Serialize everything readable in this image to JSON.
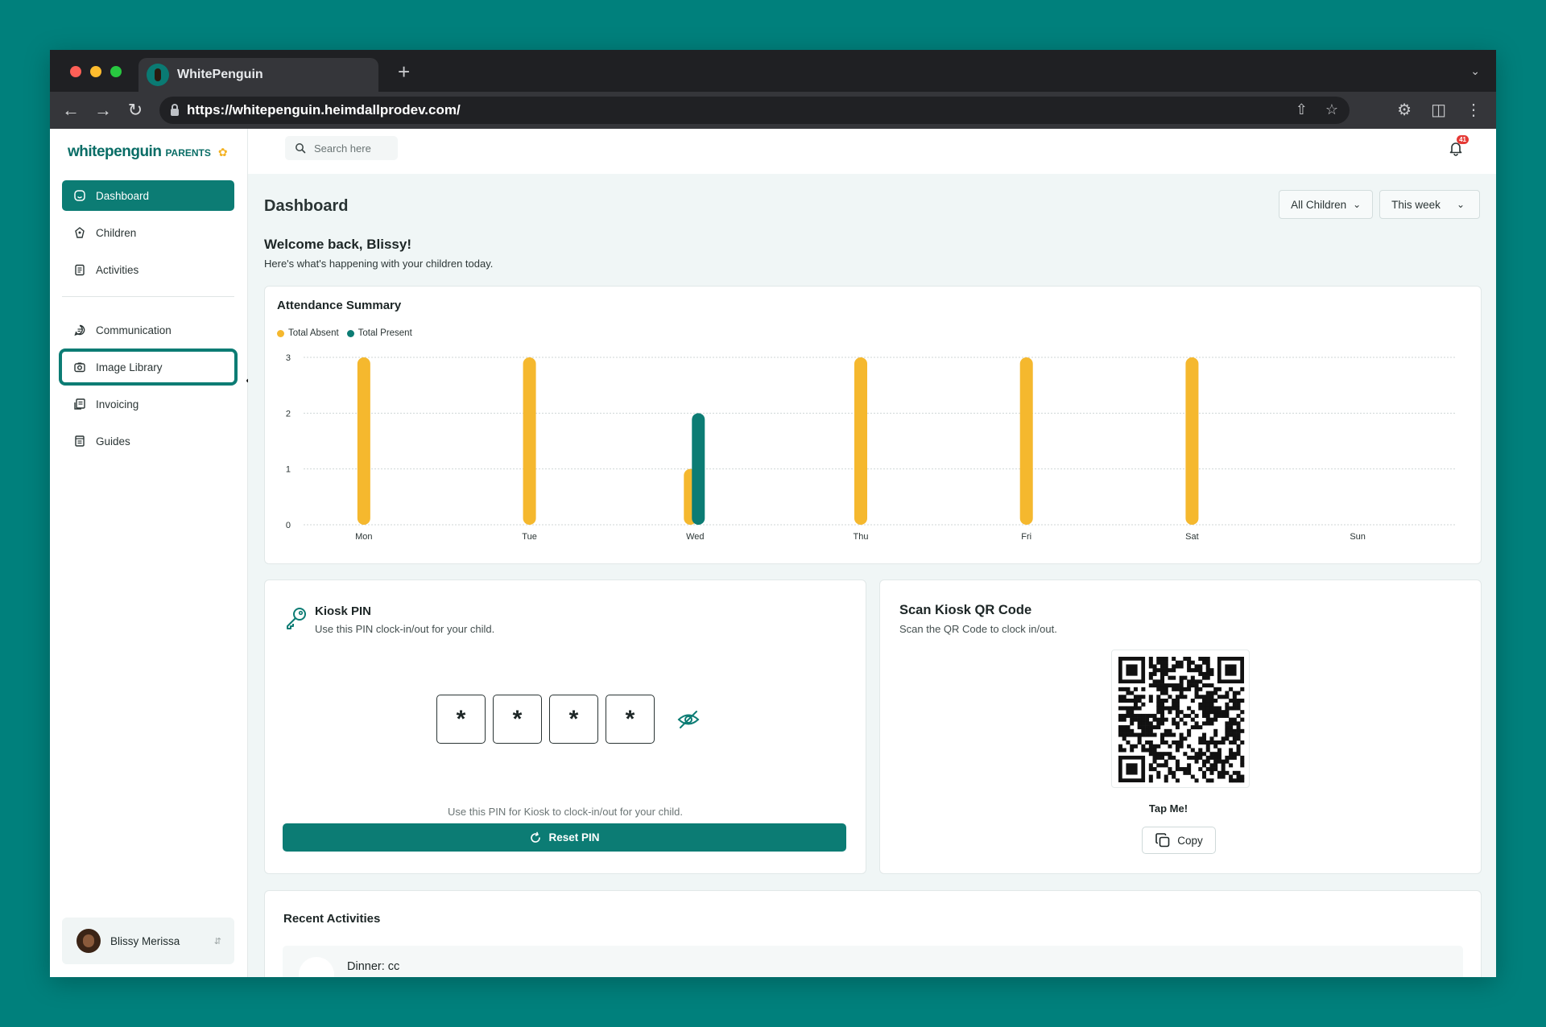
{
  "browser": {
    "tab_title": "WhitePenguin",
    "url": "https://whitepenguin.heimdallprodev.com/"
  },
  "brand": {
    "name": "whitepenguin",
    "tag": "PARENTS"
  },
  "sidebar": {
    "items": [
      {
        "label": "Dashboard",
        "icon": "dashboard-icon",
        "active": true
      },
      {
        "label": "Children",
        "icon": "children-icon"
      },
      {
        "label": "Activities",
        "icon": "activities-icon"
      },
      {
        "label": "Communication",
        "icon": "chat-icon"
      },
      {
        "label": "Image Library",
        "icon": "camera-icon",
        "highlighted": true
      },
      {
        "label": "Invoicing",
        "icon": "invoice-icon"
      },
      {
        "label": "Guides",
        "icon": "book-icon"
      }
    ],
    "user": {
      "name": "Blissy Merissa"
    }
  },
  "topbar": {
    "search_placeholder": "Search here",
    "notification_count": "41"
  },
  "page": {
    "title": "Dashboard",
    "filters": {
      "children": "All Children",
      "period": "This week"
    },
    "welcome_title": "Welcome back, Blissy!",
    "welcome_sub": "Here's what's happening with your children today."
  },
  "attendance": {
    "title": "Attendance Summary"
  },
  "chart_data": {
    "type": "bar",
    "title": "Attendance Summary",
    "categories": [
      "Mon",
      "Tue",
      "Wed",
      "Thu",
      "Fri",
      "Sat",
      "Sun"
    ],
    "series": [
      {
        "name": "Total Absent",
        "color": "#f5b82e",
        "values": [
          3,
          3,
          1,
          3,
          3,
          3,
          0
        ]
      },
      {
        "name": "Total Present",
        "color": "#0c7c74",
        "values": [
          0,
          0,
          2,
          0,
          0,
          0,
          0
        ]
      }
    ],
    "yticks": [
      0,
      1,
      2,
      3
    ],
    "ylim": [
      0,
      3
    ],
    "grid": true,
    "legend": "top-left"
  },
  "kiosk_pin": {
    "title": "Kiosk PIN",
    "subtitle": "Use this PIN clock-in/out for your child.",
    "digits": [
      "*",
      "*",
      "*",
      "*"
    ],
    "hint": "Use this PIN for Kiosk to clock-in/out for your child.",
    "reset_label": "Reset PIN"
  },
  "kiosk_qr": {
    "title": "Scan Kiosk QR Code",
    "subtitle": "Scan the QR Code to clock in/out.",
    "tap_label": "Tap Me!",
    "copy_label": "Copy"
  },
  "recent": {
    "title": "Recent Activities",
    "first_item": "Dinner: cc"
  },
  "colors": {
    "brand": "#0c7c74",
    "absent": "#f5b82e",
    "background": "#00807c"
  }
}
